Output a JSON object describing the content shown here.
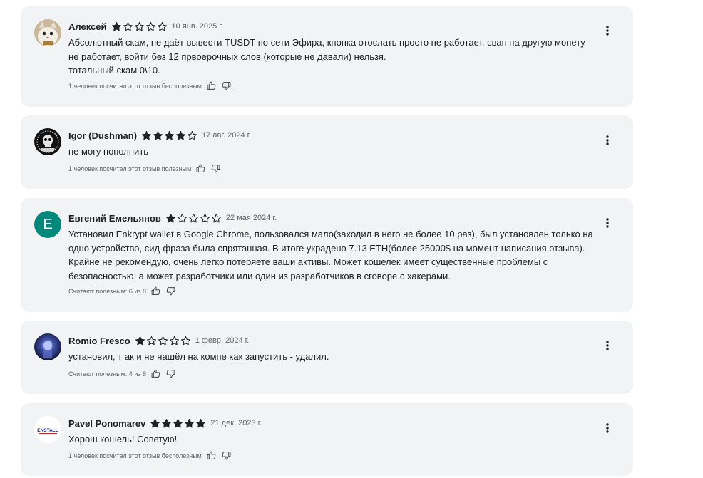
{
  "reviews": [
    {
      "author": "Алексей",
      "rating": 1,
      "date": "10 янв. 2025 г.",
      "text_lines": [
        "Абсолютный скам, не даёт вывести TUSDT по сети Эфира, кнопка отослать просто не работает, свап на другую монету",
        "не работает, войти без 12 првоерочных слов (которые не давали) нельзя.",
        "тотальный скам 0\\10."
      ],
      "helpful": "1 человек посчитал этот отзыв бесполезным",
      "avatar": "cat-photo-avatar"
    },
    {
      "author": "Igor (Dushman)",
      "rating": 4,
      "date": "17 авг. 2024 г.",
      "text_lines": [
        "не могу пополнить"
      ],
      "helpful": "1 человек посчитал этот отзыв полезным",
      "avatar": "skull-logo-avatar"
    },
    {
      "author": "Евгений Емельянов",
      "rating": 1,
      "date": "22 мая 2024 г.",
      "text_lines": [
        "Установил Enkrypt wallet в Google Chrome, пользовался мало(заходил в него не более 10 раз), был установлен только на",
        "одно устройство, сид-фраза была спрятанная.  В итоге украдено 7.13 ETH(более 25000$ на момент написания отзыва).",
        "Крайне не рекомендую, очень легко потеряете ваши активы. Может кошелек имеет существенные проблемы с",
        "безопасностью, а может разработчики или один из разработчиков в сговоре с хакерами."
      ],
      "helpful": "Считают полезным: 6 из 8",
      "avatar_letter": "E",
      "avatar_color": "#00897b"
    },
    {
      "author": "Romio Fresco",
      "rating": 1,
      "date": "1 февр. 2024 г.",
      "text_lines": [
        "установил, т ак и не нашёл на компе как запустить - удалил."
      ],
      "helpful": "Считают полезным: 4 из 8",
      "avatar": "space-photo-avatar"
    },
    {
      "author": "Pavel Ponomarev",
      "rating": 5,
      "date": "21 дек. 2023 г.",
      "text_lines": [
        "Хорош кошель! Советую!"
      ],
      "helpful": "1 человек посчитал этот отзыв бесполезным",
      "avatar": "enstall-logo-avatar",
      "avatar_text": "ENSTALL"
    }
  ],
  "icons": {
    "star_filled": "star-filled-icon",
    "star_empty": "star-outline-icon",
    "thumb_up": "thumb-up-icon",
    "thumb_down": "thumb-down-icon",
    "menu": "more-vert-icon"
  },
  "colors": {
    "card_bg": "#f1f3f4",
    "star": "#202124",
    "letter_avatar": "#00897b"
  }
}
